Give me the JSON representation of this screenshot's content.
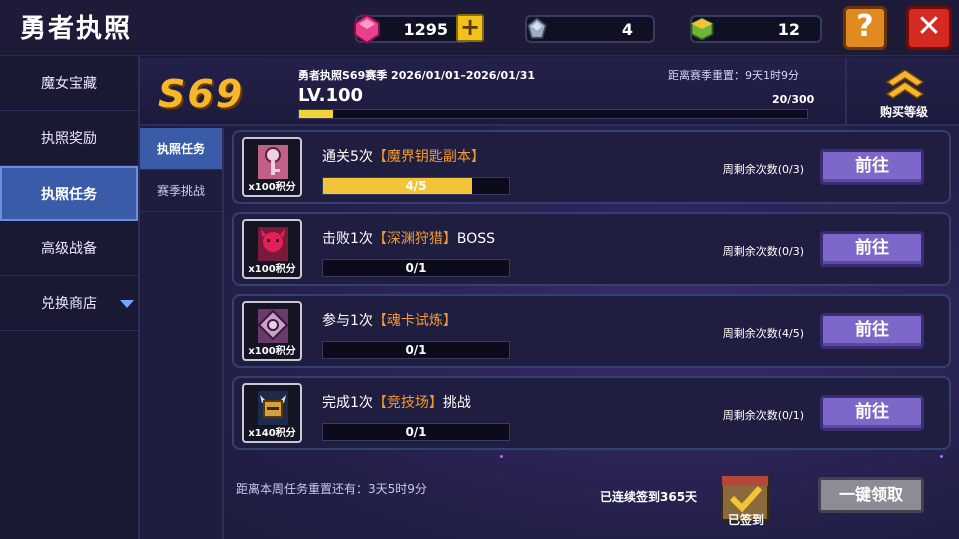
{
  "window": {
    "title": "勇者执照"
  },
  "resources": {
    "gems": "1295",
    "crystals": "4",
    "cubes": "12"
  },
  "sidebar": {
    "items": [
      {
        "label": "魔女宝藏"
      },
      {
        "label": "执照奖励"
      },
      {
        "label": "执照任务"
      },
      {
        "label": "高级战备"
      },
      {
        "label": "兑换商店"
      }
    ]
  },
  "header": {
    "season_badge": "S69",
    "season_title": "勇者执照S69赛季 2026/01/01–2026/01/31",
    "countdown": "距离赛季重置：9天1时9分",
    "level": "LV.100",
    "exp": "20/300",
    "exp_fraction": 0.067,
    "buy_level": "购买等级"
  },
  "subtabs": [
    {
      "label": "执照任务"
    },
    {
      "label": "赛季挑战"
    }
  ],
  "tasks": [
    {
      "prefix": "通关5次",
      "highlight": "【魔界钥匙副本】",
      "suffix": "",
      "points": "x100积分",
      "progress": "4/5",
      "progress_fraction": 0.8,
      "remain": "周剩余次数(0/3)",
      "button": "前往",
      "icon": "key-icon"
    },
    {
      "prefix": "击败1次",
      "highlight": "【深渊狩猎】",
      "suffix": "BOSS",
      "points": "x100积分",
      "progress": "0/1",
      "progress_fraction": 0,
      "remain": "周剩余次数(0/3)",
      "button": "前往",
      "icon": "demon-icon"
    },
    {
      "prefix": "参与1次",
      "highlight": "【魂卡试炼】",
      "suffix": "",
      "points": "x100积分",
      "progress": "0/1",
      "progress_fraction": 0,
      "remain": "周剩余次数(4/5)",
      "button": "前往",
      "icon": "card-icon"
    },
    {
      "prefix": "完成1次",
      "highlight": "【竞技场】",
      "suffix": "挑战",
      "points": "x140积分",
      "progress": "0/1",
      "progress_fraction": 0,
      "remain": "周剩余次数(0/1)",
      "button": "前往",
      "icon": "helmet-icon"
    }
  ],
  "footer": {
    "reset_note": "距离本周任务重置还有：3天5时9分",
    "signed_days": "已连续签到365天",
    "signed_label": "已签到",
    "claim_all": "一键领取"
  },
  "colors": {
    "accent_gold": "#f7b72b",
    "highlight_orange": "#f39a2c",
    "button_purple": "#7d68c9",
    "sidebar_active": "#3a5ba8"
  }
}
